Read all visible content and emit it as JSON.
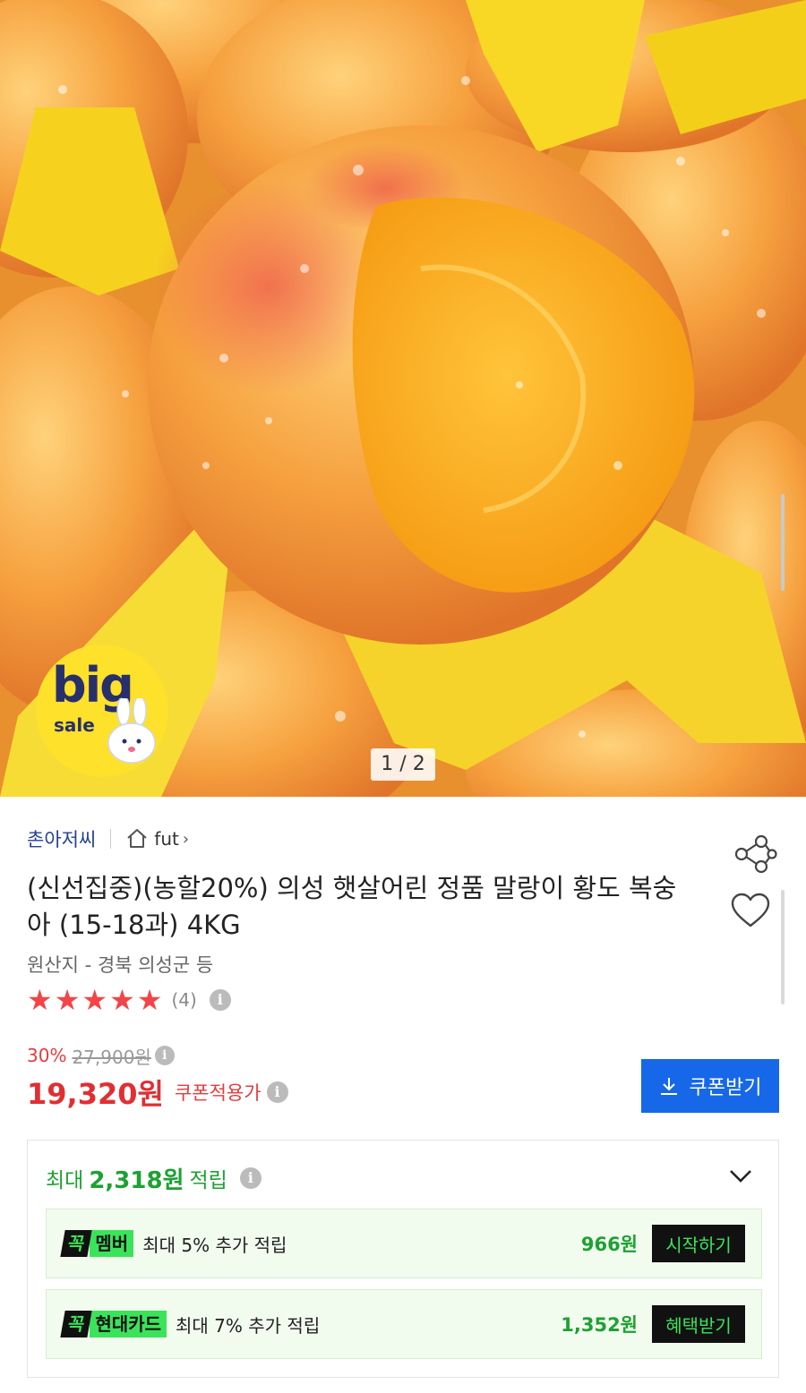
{
  "gallery": {
    "counter": "1 / 2",
    "badge": {
      "big": "big",
      "sale": "sale"
    }
  },
  "seller": {
    "name": "촌아저씨",
    "store_link": "fut",
    "chevron": "›"
  },
  "product": {
    "title": "(신선집중)(농할20%) 의성 햇살어린 정품 말랑이 황도 복숭아 (15-18과) 4KG",
    "origin": "원산지 - 경북 의성군 등",
    "rating": 5,
    "stars": [
      "★",
      "★",
      "★",
      "★",
      "★"
    ],
    "review_count": "(4)"
  },
  "pricing": {
    "discount_rate": "30%",
    "original_price": "27,900원",
    "sale_price": "19,320원",
    "price_label": "쿠폰적용가",
    "coupon_button": "쿠폰받기"
  },
  "points": {
    "max_label": "최대",
    "max_amount": "2,318원",
    "suffix": "적립",
    "benefits": [
      {
        "mark": "꼭",
        "badge": "멤버",
        "text": "최대 5% 추가 적립",
        "amount": "966원",
        "button": "시작하기"
      },
      {
        "mark": "꼭",
        "badge": "현대카드",
        "text": "최대 7% 추가 적립",
        "amount": "1,352원",
        "button": "혜택받기"
      }
    ]
  },
  "icons": {
    "info": "i",
    "share": "share-icon",
    "heart": "heart-icon",
    "home": "home-icon",
    "download": "download-icon",
    "chevron_down": "chevron-down-icon"
  },
  "colors": {
    "accent_blue": "#1668e8",
    "price_red": "#e02f33",
    "star_red": "#f44447",
    "points_green": "#1ea133",
    "kkok_green": "#3be35a"
  }
}
